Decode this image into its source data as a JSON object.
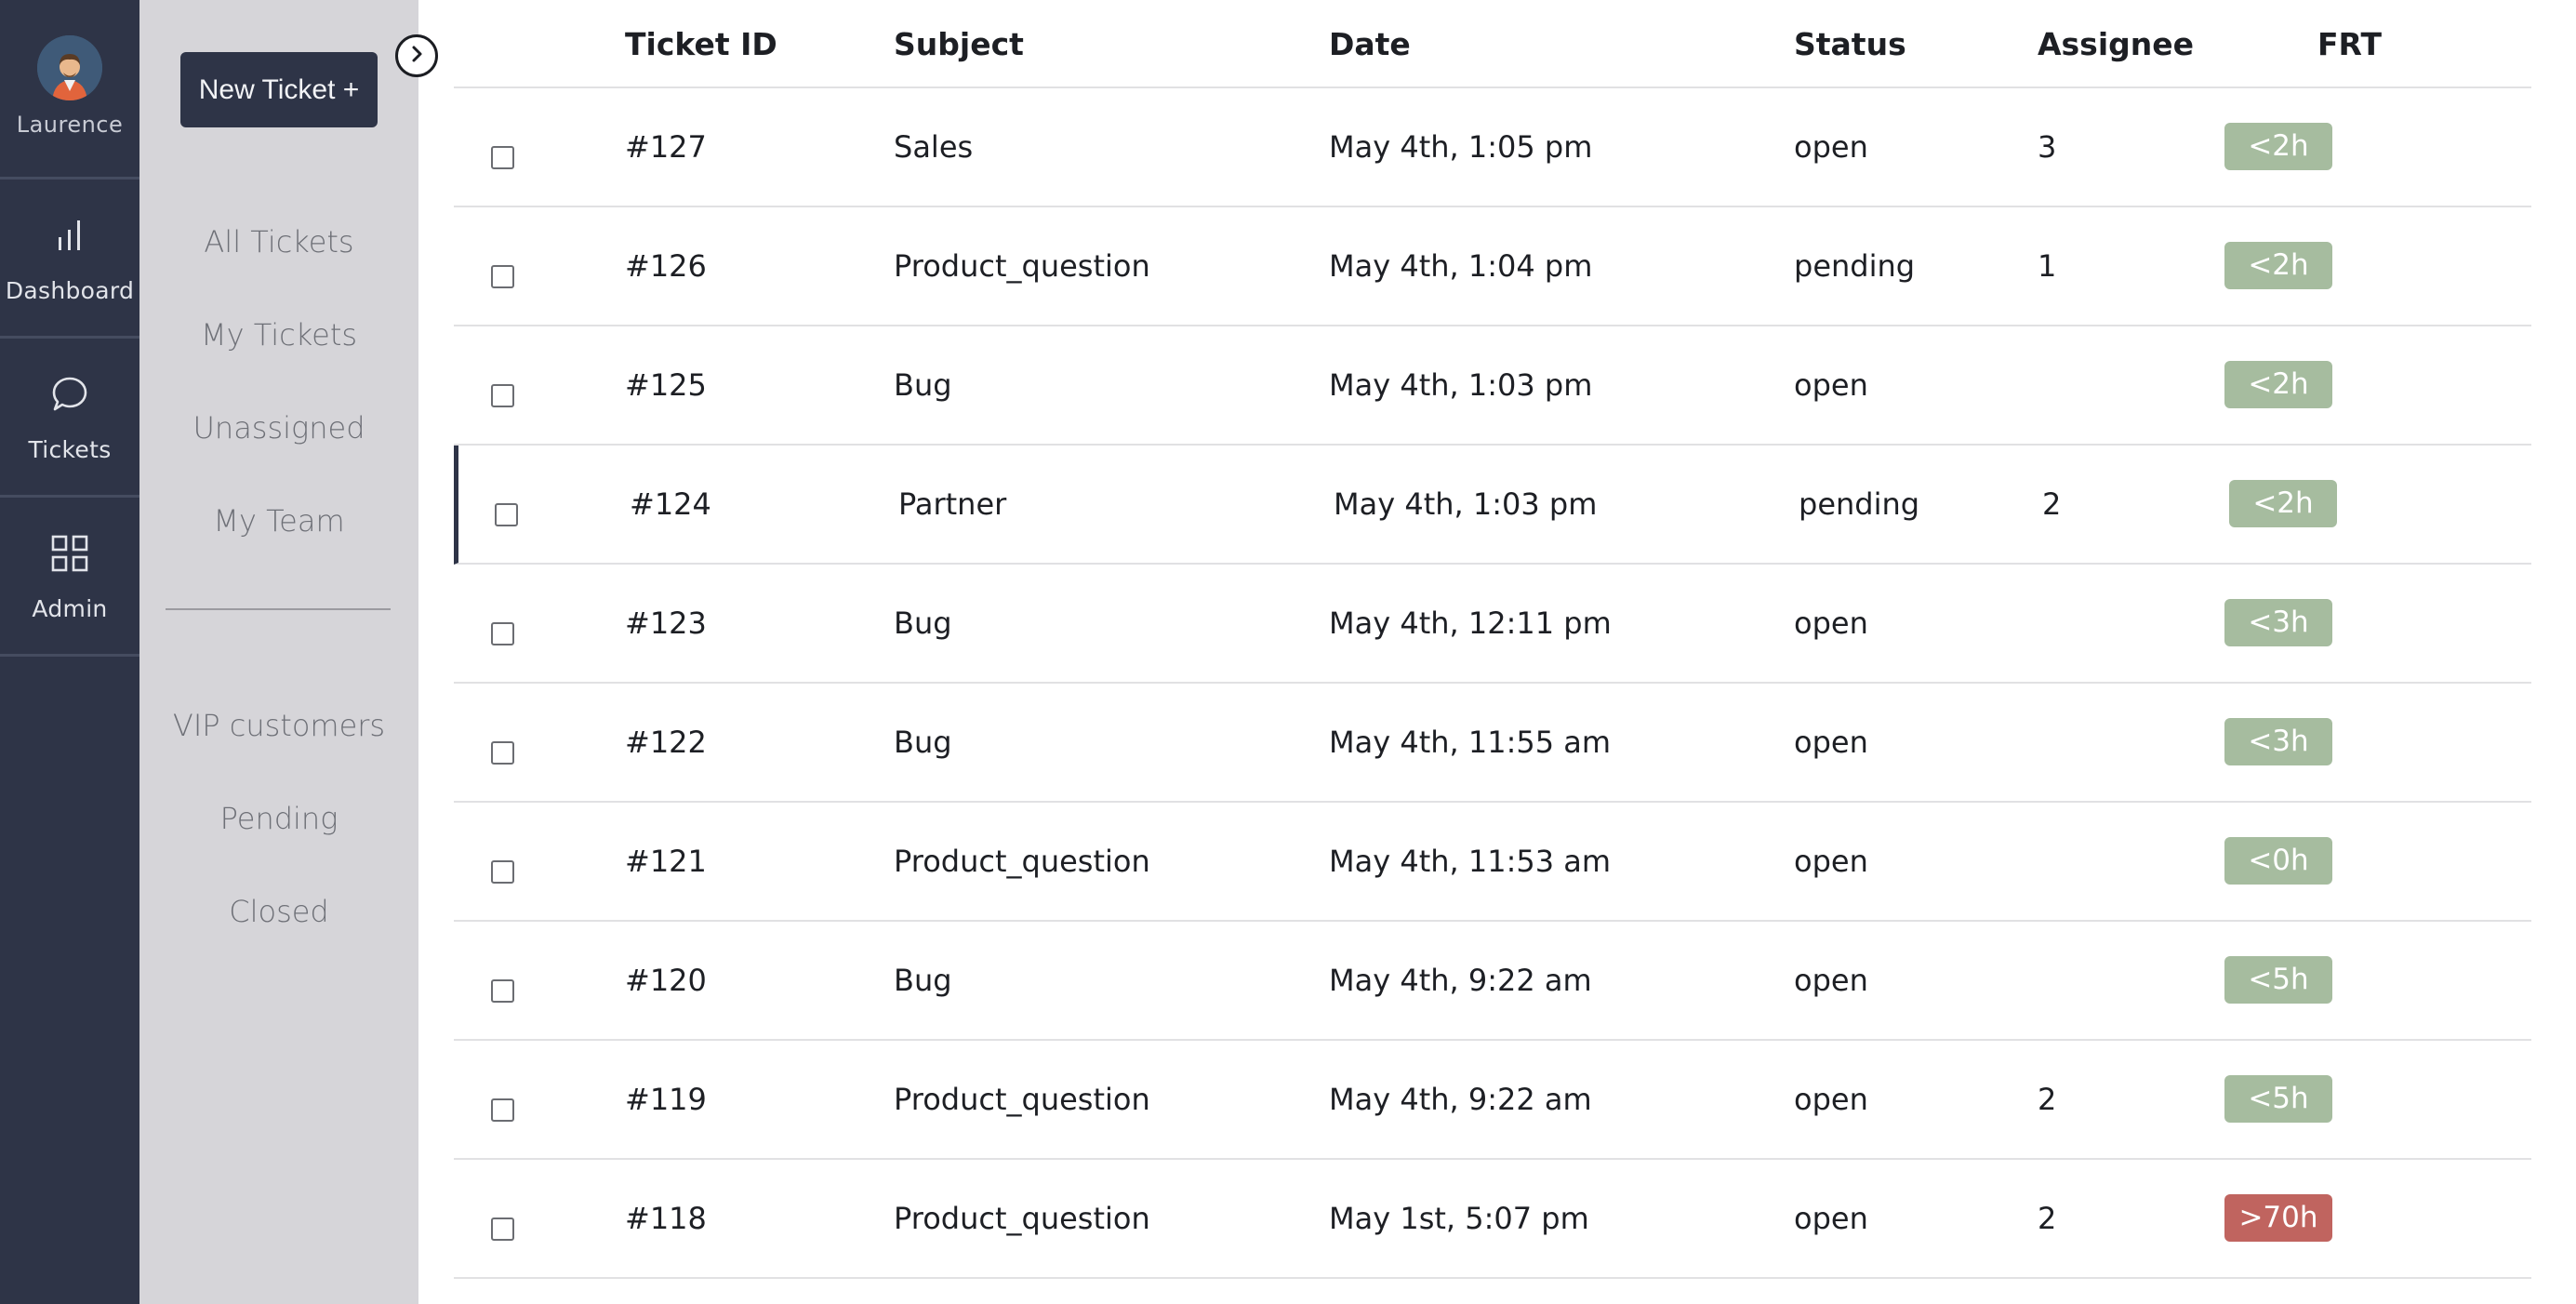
{
  "user": {
    "name": "Laurence"
  },
  "rail": [
    {
      "label": "Dashboard",
      "icon": "bar-chart-icon"
    },
    {
      "label": "Tickets",
      "icon": "chat-bubble-icon"
    },
    {
      "label": "Admin",
      "icon": "grid-icon"
    }
  ],
  "sidebar": {
    "new_ticket_label": "New Ticket +",
    "nav": [
      "All Tickets",
      "My Tickets",
      "Unassigned",
      "My Team"
    ],
    "views": [
      "VIP customers",
      "Pending",
      "Closed"
    ]
  },
  "table": {
    "headers": {
      "id": "Ticket ID",
      "subject": "Subject",
      "date": "Date",
      "status": "Status",
      "assignee": "Assignee",
      "frt": "FRT"
    },
    "rows": [
      {
        "id": "#127",
        "subject": "Sales",
        "date": "May 4th, 1:05 pm",
        "status": "open",
        "assignee": "3",
        "frt": "<2h",
        "frt_color": "#a6bc9f"
      },
      {
        "id": "#126",
        "subject": "Product_question",
        "date": "May 4th, 1:04 pm",
        "status": "pending",
        "assignee": "1",
        "frt": "<2h",
        "frt_color": "#a6bc9f"
      },
      {
        "id": "#125",
        "subject": "Bug",
        "date": "May 4th, 1:03 pm",
        "status": "open",
        "assignee": "",
        "frt": "<2h",
        "frt_color": "#a6bc9f"
      },
      {
        "id": "#124",
        "subject": "Partner",
        "date": "May 4th, 1:03 pm",
        "status": "pending",
        "assignee": "2",
        "frt": "<2h",
        "frt_color": "#a6bc9f",
        "selected": true
      },
      {
        "id": "#123",
        "subject": "Bug",
        "date": "May 4th, 12:11 pm",
        "status": "open",
        "assignee": "",
        "frt": "<3h",
        "frt_color": "#a6bc9f"
      },
      {
        "id": "#122",
        "subject": "Bug",
        "date": "May 4th, 11:55 am",
        "status": "open",
        "assignee": "",
        "frt": "<3h",
        "frt_color": "#a6bc9f"
      },
      {
        "id": "#121",
        "subject": "Product_question",
        "date": "May 4th, 11:53 am",
        "status": "open",
        "assignee": "",
        "frt": "<0h",
        "frt_color": "#a6bc9f"
      },
      {
        "id": "#120",
        "subject": "Bug",
        "date": "May 4th, 9:22 am",
        "status": "open",
        "assignee": "",
        "frt": "<5h",
        "frt_color": "#a6bc9f"
      },
      {
        "id": "#119",
        "subject": "Product_question",
        "date": "May 4th, 9:22 am",
        "status": "open",
        "assignee": "2",
        "frt": "<5h",
        "frt_color": "#a6bc9f"
      },
      {
        "id": "#118",
        "subject": "Product_question",
        "date": "May 1st, 5:07 pm",
        "status": "open",
        "assignee": "2",
        "frt": ">70h",
        "frt_color": "#c0645f"
      }
    ]
  },
  "colors": {
    "rail_bg": "#2e3447",
    "sidebar_bg": "#d6d5d9",
    "badge_green": "#a6bc9f",
    "badge_red": "#c0645f"
  }
}
